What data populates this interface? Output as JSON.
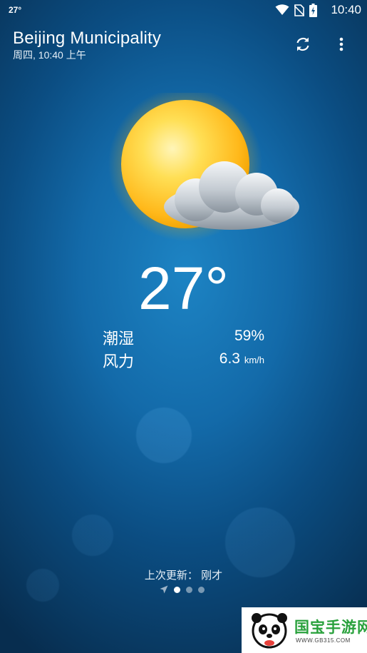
{
  "status_bar": {
    "temperature": "27°",
    "time": "10:40"
  },
  "header": {
    "location": "Beijing Municipality",
    "datetime": "周四, 10:40 上午",
    "refresh_icon": "refresh-icon",
    "more_icon": "more-vertical-icon"
  },
  "weather": {
    "icon": "partly-cloudy-icon",
    "temperature": "27°",
    "details": [
      {
        "label": "潮湿",
        "value": "59%",
        "unit": ""
      },
      {
        "label": "风力",
        "value": "6.3",
        "unit": "km/h"
      }
    ]
  },
  "footer": {
    "last_updated": "上次更新： 刚才",
    "page_count": 3,
    "current_page": 1
  },
  "watermark": {
    "name": "国宝手游网",
    "url": "WWW.GB315.COM"
  },
  "colors": {
    "background": "#0b4d82",
    "text": "#ffffff",
    "sun": "#ffc21a",
    "watermark_green": "#29a13c"
  }
}
